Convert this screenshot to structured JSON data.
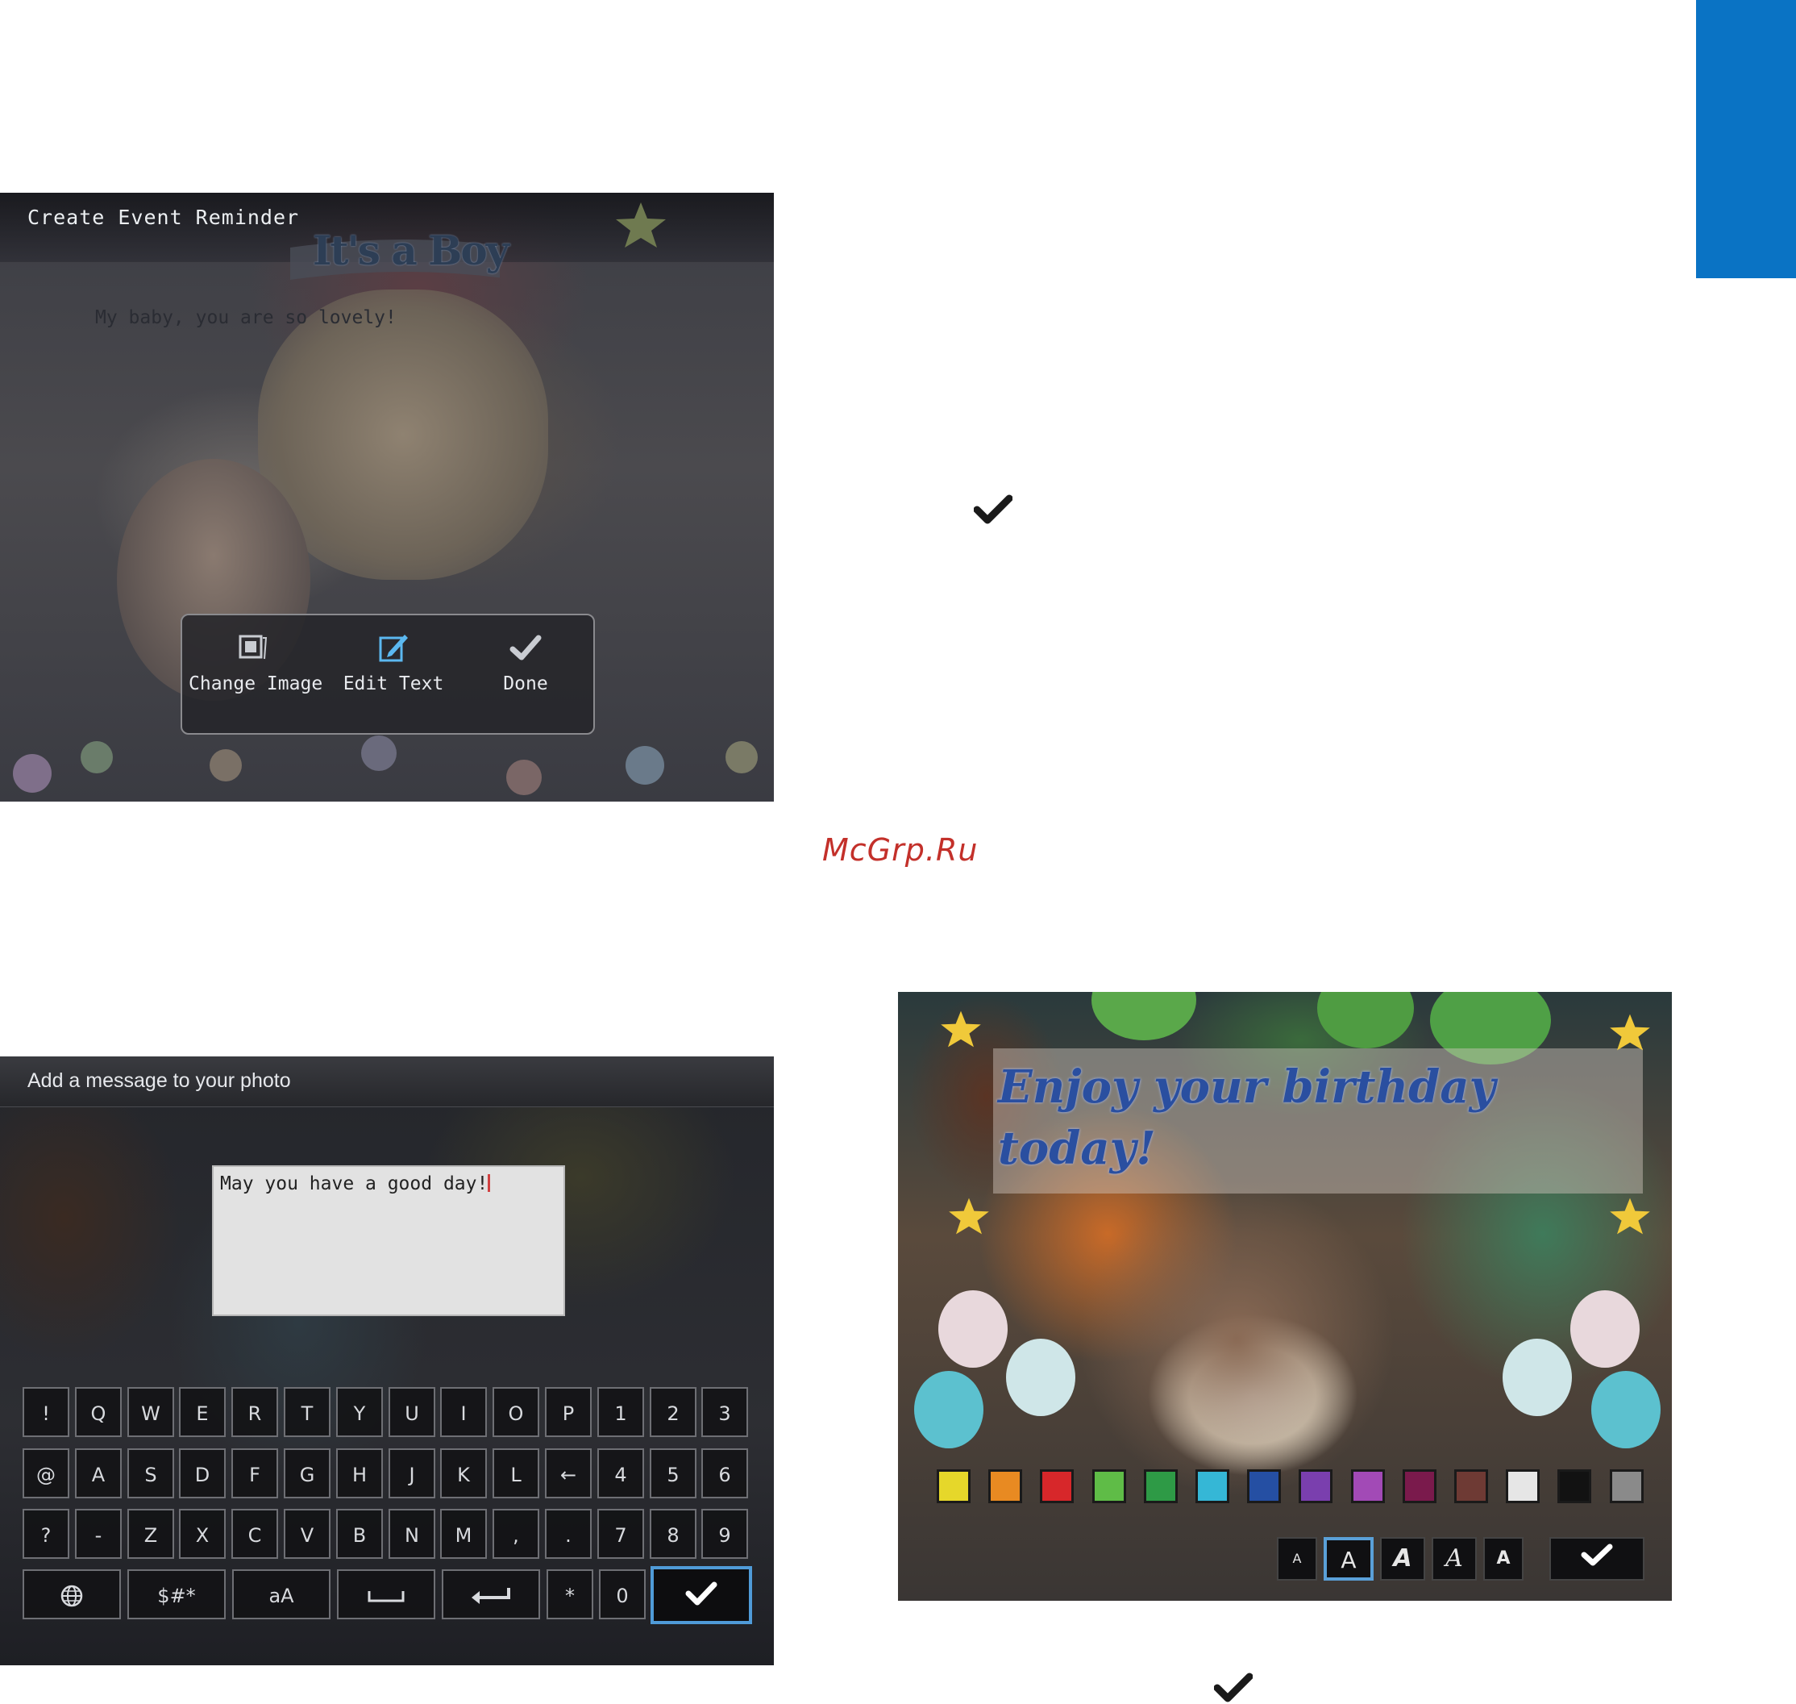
{
  "screen1": {
    "title": "Create Event Reminder",
    "banner_text": "It's a Boy",
    "subtitle": "My baby, you are so lovely!",
    "popup": [
      {
        "label": "Change Image",
        "icon": "change-image-icon"
      },
      {
        "label": "Edit Text",
        "icon": "edit-text-icon"
      },
      {
        "label": "Done",
        "icon": "checkmark-icon"
      }
    ]
  },
  "screen2": {
    "title": "Add a message to your photo",
    "message": "May you have a good day!",
    "keyboard": {
      "row1": [
        "!",
        "Q",
        "W",
        "E",
        "R",
        "T",
        "Y",
        "U",
        "I",
        "O",
        "P",
        "1",
        "2",
        "3"
      ],
      "row2": [
        "@",
        "A",
        "S",
        "D",
        "F",
        "G",
        "H",
        "J",
        "K",
        "L",
        "←",
        "4",
        "5",
        "6"
      ],
      "row3": [
        "?",
        "-",
        "Z",
        "X",
        "C",
        "V",
        "B",
        "N",
        "M",
        ",",
        ".",
        "7",
        "8",
        "9"
      ],
      "row4": [
        "",
        "$#*",
        "aA",
        "",
        "",
        "*",
        "0",
        ""
      ]
    }
  },
  "screen3": {
    "caption": "Enjoy your birthday today!",
    "colors": [
      "#e6d72a",
      "#e88a22",
      "#d7272a",
      "#5fbc47",
      "#2e9a46",
      "#35b7d6",
      "#254fa3",
      "#7a3fae",
      "#a24ab6",
      "#7a1a4c",
      "#6e3a34",
      "#e6e6e6",
      "#121212",
      "#8a8a8a"
    ],
    "font_styles": [
      "A",
      "A",
      "A",
      "A",
      "A"
    ]
  },
  "watermark": "McGrp.Ru",
  "colors": {
    "accent_blue": "#0a73c4",
    "selected_border": "#4f9bd8"
  }
}
